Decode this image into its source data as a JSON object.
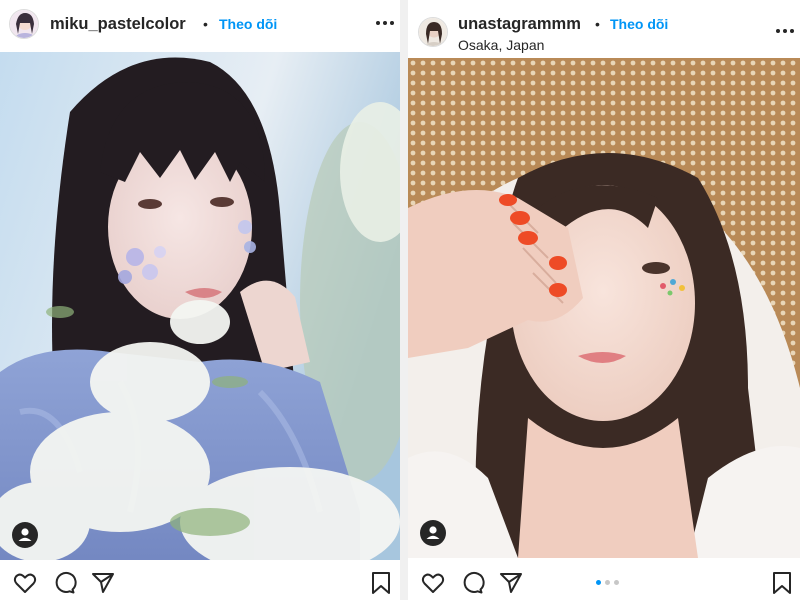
{
  "posts": [
    {
      "username": "miku_pastelcolor",
      "separator": "•",
      "follow_label": "Theo dõi",
      "location": "",
      "more_icon": "more-horizontal-icon",
      "user_tag_icon": "user-tag-icon",
      "actions": [
        "like-icon",
        "comment-icon",
        "share-icon",
        "save-icon"
      ],
      "colors": {
        "follow": "#0095f6",
        "text": "#262626"
      }
    },
    {
      "username": "unastagrammm",
      "separator": "•",
      "follow_label": "Theo dõi",
      "location": "Osaka, Japan",
      "more_icon": "more-horizontal-icon",
      "user_tag_icon": "user-tag-icon",
      "actions": [
        "like-icon",
        "comment-icon",
        "share-icon",
        "save-icon"
      ],
      "carousel": {
        "count": 3,
        "active": 0,
        "active_color": "#0095f6",
        "inactive_color": "#c7c7c7"
      }
    }
  ]
}
